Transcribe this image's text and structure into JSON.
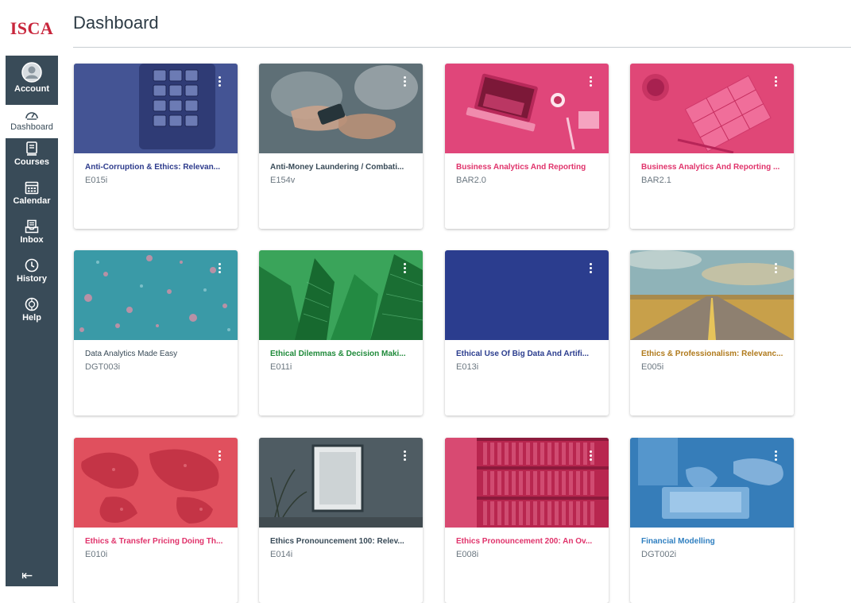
{
  "brand": {
    "logo_text": "ISCA",
    "logo_color": "#c8253b"
  },
  "sidebar": {
    "bg_color": "#394b58",
    "items": [
      {
        "label": "Account",
        "icon": "avatar-icon",
        "active": false
      },
      {
        "label": "Dashboard",
        "icon": "dashboard-gauge-icon",
        "active": true
      },
      {
        "label": "Courses",
        "icon": "book-icon",
        "active": false
      },
      {
        "label": "Calendar",
        "icon": "calendar-icon",
        "active": false
      },
      {
        "label": "Inbox",
        "icon": "inbox-icon",
        "active": false
      },
      {
        "label": "History",
        "icon": "clock-icon",
        "active": false
      },
      {
        "label": "Help",
        "icon": "help-icon",
        "active": false
      }
    ],
    "collapse_icon": "⇤"
  },
  "header": {
    "title": "Dashboard"
  },
  "courses": [
    {
      "title": "Anti-Corruption & Ethics: Relevan...",
      "code": "E015i",
      "color": "#2d3b8c",
      "image": "keypad"
    },
    {
      "title": "Anti-Money Laundering / Combati...",
      "code": "E154v",
      "color": "#394b58",
      "image": "handshake"
    },
    {
      "title": "Business Analytics And Reporting",
      "code": "BAR2.0",
      "color": "#e0336b",
      "image": "laptop"
    },
    {
      "title": "Business Analytics And Reporting ...",
      "code": "BAR2.1",
      "color": "#e0336b",
      "image": "desk-papers"
    },
    {
      "title": "Data Analytics Made Easy",
      "code": "DGT003i",
      "color": "#394b58",
      "image": "bokeh"
    },
    {
      "title": "Ethical Dilemmas & Decision Maki...",
      "code": "E011i",
      "color": "#1f8a3a",
      "image": "skyscrapers"
    },
    {
      "title": "Ethical Use Of Big Data And Artifi...",
      "code": "E013i",
      "color": "#2b3d8e",
      "image": "solid"
    },
    {
      "title": "Ethics & Professionalism: Relevanc...",
      "code": "E005i",
      "color": "#b07a1c",
      "image": "road"
    },
    {
      "title": "Ethics & Transfer Pricing Doing Th...",
      "code": "E010i",
      "color": "#e0336b",
      "image": "world-map"
    },
    {
      "title": "Ethics Pronouncement 100: Relev...",
      "code": "E014i",
      "color": "#394b58",
      "image": "frame-plant"
    },
    {
      "title": "Ethics Pronouncement 200: An Ov...",
      "code": "E008i",
      "color": "#e0336b",
      "image": "bookshelf"
    },
    {
      "title": "Financial Modelling",
      "code": "DGT002i",
      "color": "#2f7fc0",
      "image": "laptop-hands"
    }
  ]
}
